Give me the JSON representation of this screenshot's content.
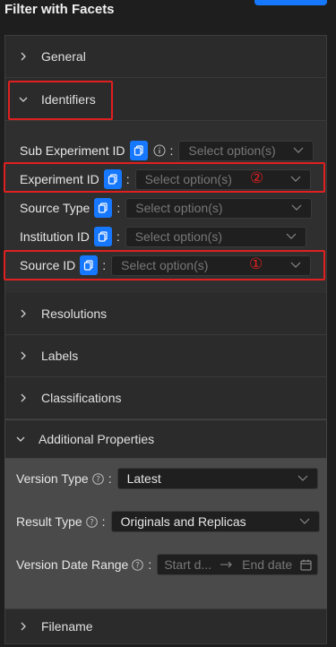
{
  "header": {
    "title": "Filter with Facets"
  },
  "sections": {
    "general": "General",
    "identifiers": "Identifiers",
    "resolutions": "Resolutions",
    "labels": "Labels",
    "classifications": "Classifications",
    "additional": "Additional Properties",
    "filename": "Filename"
  },
  "identifiers": {
    "fields": [
      {
        "label": "Sub Experiment ID",
        "placeholder": "Select option(s)"
      },
      {
        "label": "Experiment ID",
        "placeholder": "Select option(s)"
      },
      {
        "label": "Source Type",
        "placeholder": "Select option(s)"
      },
      {
        "label": "Institution ID",
        "placeholder": "Select option(s)"
      },
      {
        "label": "Source ID",
        "placeholder": "Select option(s)"
      }
    ],
    "annotations": {
      "experiment": "②",
      "source": "①"
    },
    "colon": ":"
  },
  "additional": {
    "version_type": {
      "label": "Version Type",
      "value": "Latest"
    },
    "result_type": {
      "label": "Result Type",
      "value": "Originals and Replicas"
    },
    "version_date_range": {
      "label": "Version Date Range",
      "start_placeholder": "Start d...",
      "end_placeholder": "End date"
    },
    "colon": ":"
  },
  "colors": {
    "accent": "#1677ff",
    "highlight": "#e02020"
  }
}
